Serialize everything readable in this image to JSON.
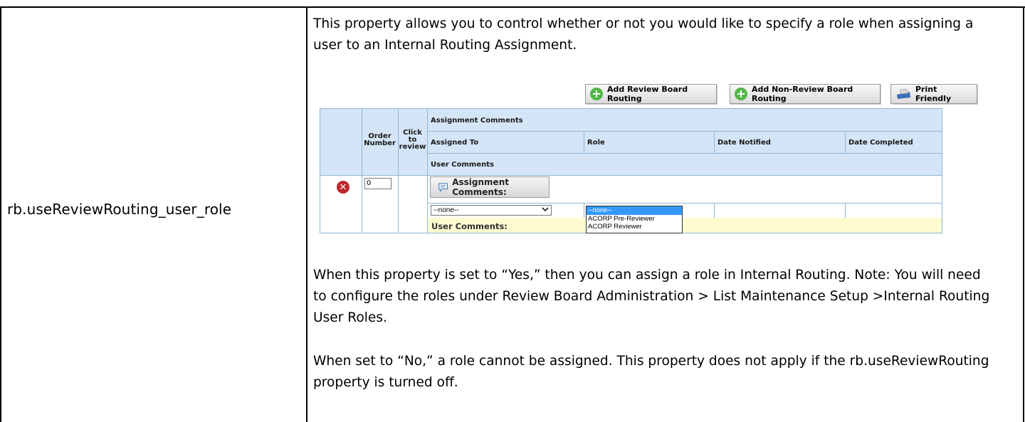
{
  "property_name": "rb.useReviewRouting_user_role",
  "description": {
    "intro_line1": "This property allows you to control whether or not you would like to specify a role when assigning a",
    "intro_line2": "user to an Internal Routing Assignment.",
    "yes_line1": "When this property is set to “Yes,” then you can assign a role in Internal Routing. Note: You will need",
    "yes_line2": "to configure the roles under Review Board Administration > List Maintenance Setup >Internal Routing",
    "yes_line3": "User Roles.",
    "no_line1": "When set to “No,” a role cannot be assigned. This property does not apply if the rb.useReviewRouting",
    "no_line2": "property is turned off."
  },
  "screenshot": {
    "buttons": {
      "add_review": "Add Review Board Routing",
      "add_non_review": "Add Non-Review Board Routing",
      "print": "Print Friendly"
    },
    "table_headers": {
      "order_number_1": "Order",
      "order_number_2": "Number",
      "click_1": "Click",
      "click_2": "to",
      "click_3": "review",
      "assignment_comments": "Assignment Comments",
      "assigned_to": "Assigned To",
      "role": "Role",
      "date_notified": "Date Notified",
      "date_completed": "Date Completed",
      "user_comments": "User Comments"
    },
    "row": {
      "order_value": "0",
      "assignment_comments_button": "Assignment Comments:",
      "assigned_to_selected": "--none--",
      "user_comments_label": "User Comments:",
      "role_options": [
        "--none--",
        "ACORP Pre-Reviewer",
        "ACORP Reviewer"
      ]
    }
  },
  "colors": {
    "header_bg": "#d4e5f7",
    "border": "#8fb6d8",
    "user_comments_bg": "#fffbd0",
    "add_icon": "#52b848",
    "delete_icon": "#c0282b",
    "selected_option": "#3399ff"
  }
}
